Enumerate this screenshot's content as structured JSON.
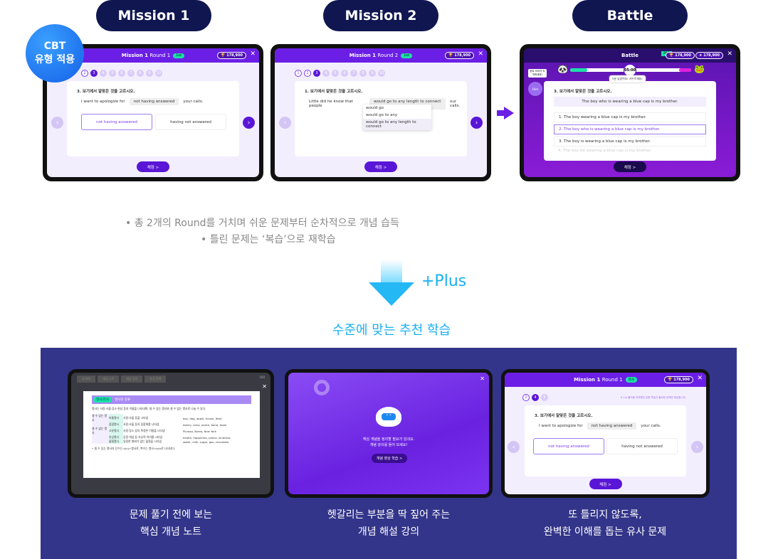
{
  "top_tabs": [
    "Mission 1",
    "Mission 2",
    "Battle"
  ],
  "badge": {
    "line1": "CBT",
    "line2": "유형 적용"
  },
  "coins": "178,900",
  "level": "1st",
  "mission1": {
    "title_bold": "Mission 1",
    "title_round": "Round 1",
    "steps": [
      "2",
      "3",
      "4",
      "5",
      "6",
      "7",
      "8",
      "9",
      "10"
    ],
    "question": "3. 보기에서 알맞은 것을 고르시오.",
    "sentence_pre": "I want to apologize for",
    "blank": "not having answered",
    "sentence_post": "your calls.",
    "options": [
      "not having answered",
      "having not answered"
    ],
    "submit": "채점 >"
  },
  "mission2": {
    "title_bold": "Mission 1",
    "title_round": "Round 2",
    "steps": [
      "1",
      "2",
      "3",
      "4",
      "5",
      "6",
      "7",
      "8",
      "9",
      "10"
    ],
    "question": "1. 보기에서 알맞은 것을 고르시오.",
    "sentence_pre": "Little did he know that people",
    "select_value": "would go to any length to connect",
    "sentence_post": "our calls.",
    "dropdown": [
      "would go",
      "would go to any",
      "would go to any length to connect"
    ],
    "submit": "채점 >"
  },
  "battle": {
    "title": "Battle",
    "rank": "200",
    "coins2": "178,900",
    "timer": "05:00",
    "hint": "Hint",
    "hint_bubble": "힌트 쓰러가 도착하세요!",
    "timer_note": "5분 남았어요! 서두르세요!",
    "question": "3. 보기에서 알맞은 것을 고르시오.",
    "prompt": "The boy who is wearing a blue cap is my brother.",
    "options": [
      "1. The boy wearing a blue cap is my brother.",
      "2. The boy who is wearing a blue cap is my brother.",
      "3.  The boy is wearing a blue cap is my brother.",
      "4. The boy be wearing a blue cap is my brother."
    ],
    "submit": "채점 >"
  },
  "bullets": [
    "• 총 2개의 Round를 거치며 쉬운 문제부터 순차적으로 개념 습득",
    "• 틀린 문제는 ‘복습’으로 재학습"
  ],
  "plus": "+Plus",
  "recommend_title": "수준에 맞는 추천 학습",
  "note": {
    "tabs": [
      "내 위치",
      "개념 노트",
      "개념 강의",
      "유사 문제"
    ],
    "score": "100",
    "tag": "명사/관사",
    "heading": "명사의 종류",
    "intro": "명사는 사람·사물·장소·현상 등의 이름을 나타내며, 셀 수 있는 명사와 셀 수 없는 명사로 나눌 수 있다.",
    "rows": [
      [
        "셀 수 있는 명사",
        "보통명사",
        "사람·사물 등을 나타냄",
        "boy, dog, apple, house, desk"
      ],
      [
        "",
        "집합명사",
        "사람·사물 등의 집합체를 나타냄",
        "family, class, police, band, team"
      ],
      [
        "셀 수 없는 명사",
        "고유명사",
        "사람·장소 등의 특정한 이름을 나타냄",
        "Picasso, Korea, New York"
      ],
      [
        "",
        "추상명사",
        "감정·개념 등 추상적 의미를 나타냄",
        "health, happiness, peace, kindness"
      ],
      [
        "",
        "물질명사",
        "일정한 형태가 없는 물질을 나타냄",
        "water, milk, sugar, gas, chocolate"
      ]
    ],
    "footnote": "• 셀 수 있는 명사의 단수는 a(n)+명사로, 복수는 명사+(e)s로 나타낸다."
  },
  "lecture": {
    "message1": "핵심 개념을 정리할 필요가 있네요.",
    "message2": "개념 강의를 들어 보세요!",
    "button": "개념 영상 학습 >"
  },
  "similar": {
    "title_bold": "Mission 1",
    "title_round": "Round 1",
    "level": "유사",
    "steps": [
      "2",
      "4",
      "5"
    ],
    "note": "※ 1st 풀이중 어려웠던 유형 학습이 필요한 문제만 제공합니다.",
    "question": "3. 보기에서 알맞은 것을 고르시오.",
    "sentence_pre": "I want to apologize for",
    "blank": "not having answered",
    "sentence_post": "your calls.",
    "options": [
      "not having answered",
      "having not answered"
    ],
    "submit": "채점 >"
  },
  "captions": [
    [
      "문제 풀기 전에 보는",
      "핵심 개념 노트"
    ],
    [
      "헷갈리는 부분을 딱 짚어 주는",
      "개념 해설 강의"
    ],
    [
      "또 틀리지 않도록,",
      "완벽한 이해를 돕는 유사 문제"
    ]
  ],
  "colors": {
    "navy": "#0f1650",
    "purple": "#6b1fe6",
    "cyan": "#1ab0f0",
    "panel": "#33358a"
  }
}
